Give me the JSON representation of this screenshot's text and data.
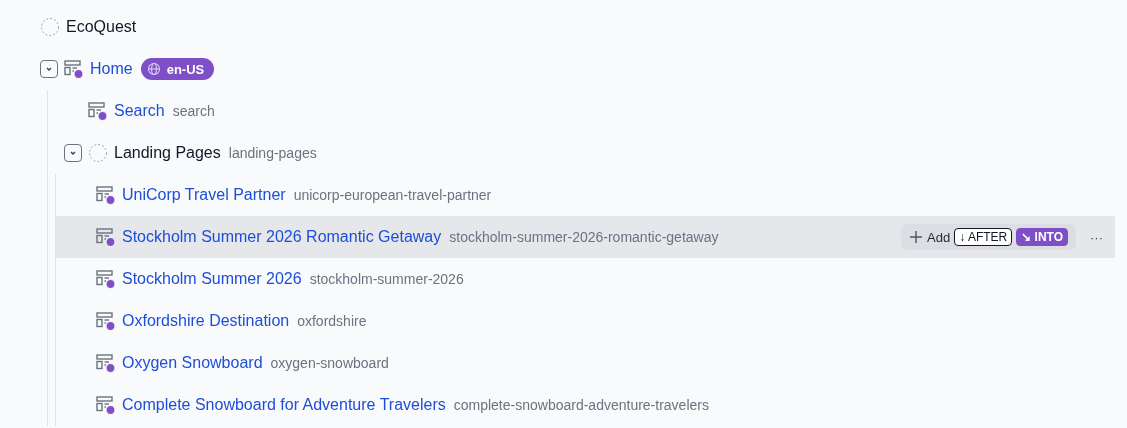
{
  "tree": [
    {
      "kind": "folder",
      "title": "EcoQuest",
      "hovered": false
    },
    {
      "kind": "page",
      "title": "Home",
      "locale": "en-US",
      "expanded": true,
      "hovered": false,
      "children": [
        {
          "kind": "page",
          "title": "Search",
          "slug": "search",
          "hovered": false
        },
        {
          "kind": "folder",
          "title": "Landing Pages",
          "slug": "landing-pages",
          "expanded": true,
          "hovered": false,
          "children": [
            {
              "kind": "page",
              "title": "UniCorp Travel Partner",
              "slug": "unicorp-european-travel-partner",
              "hovered": false
            },
            {
              "kind": "page",
              "title": "Stockholm Summer 2026 Romantic Getaway",
              "slug": "stockholm-summer-2026-romantic-getaway",
              "hovered": true,
              "actions": {
                "add": "Add",
                "after": "↓ AFTER",
                "into": "↘ INTO",
                "more": "···"
              }
            },
            {
              "kind": "page",
              "title": "Stockholm Summer 2026",
              "slug": "stockholm-summer-2026",
              "hovered": false
            },
            {
              "kind": "page",
              "title": "Oxfordshire Destination",
              "slug": "oxfordshire",
              "hovered": false
            },
            {
              "kind": "page",
              "title": "Oxygen Snowboard",
              "slug": "oxygen-snowboard",
              "hovered": false
            },
            {
              "kind": "page",
              "title": "Complete Snowboard for Adventure Travelers",
              "slug": "complete-snowboard-adventure-travelers",
              "hovered": false
            }
          ]
        }
      ]
    }
  ]
}
